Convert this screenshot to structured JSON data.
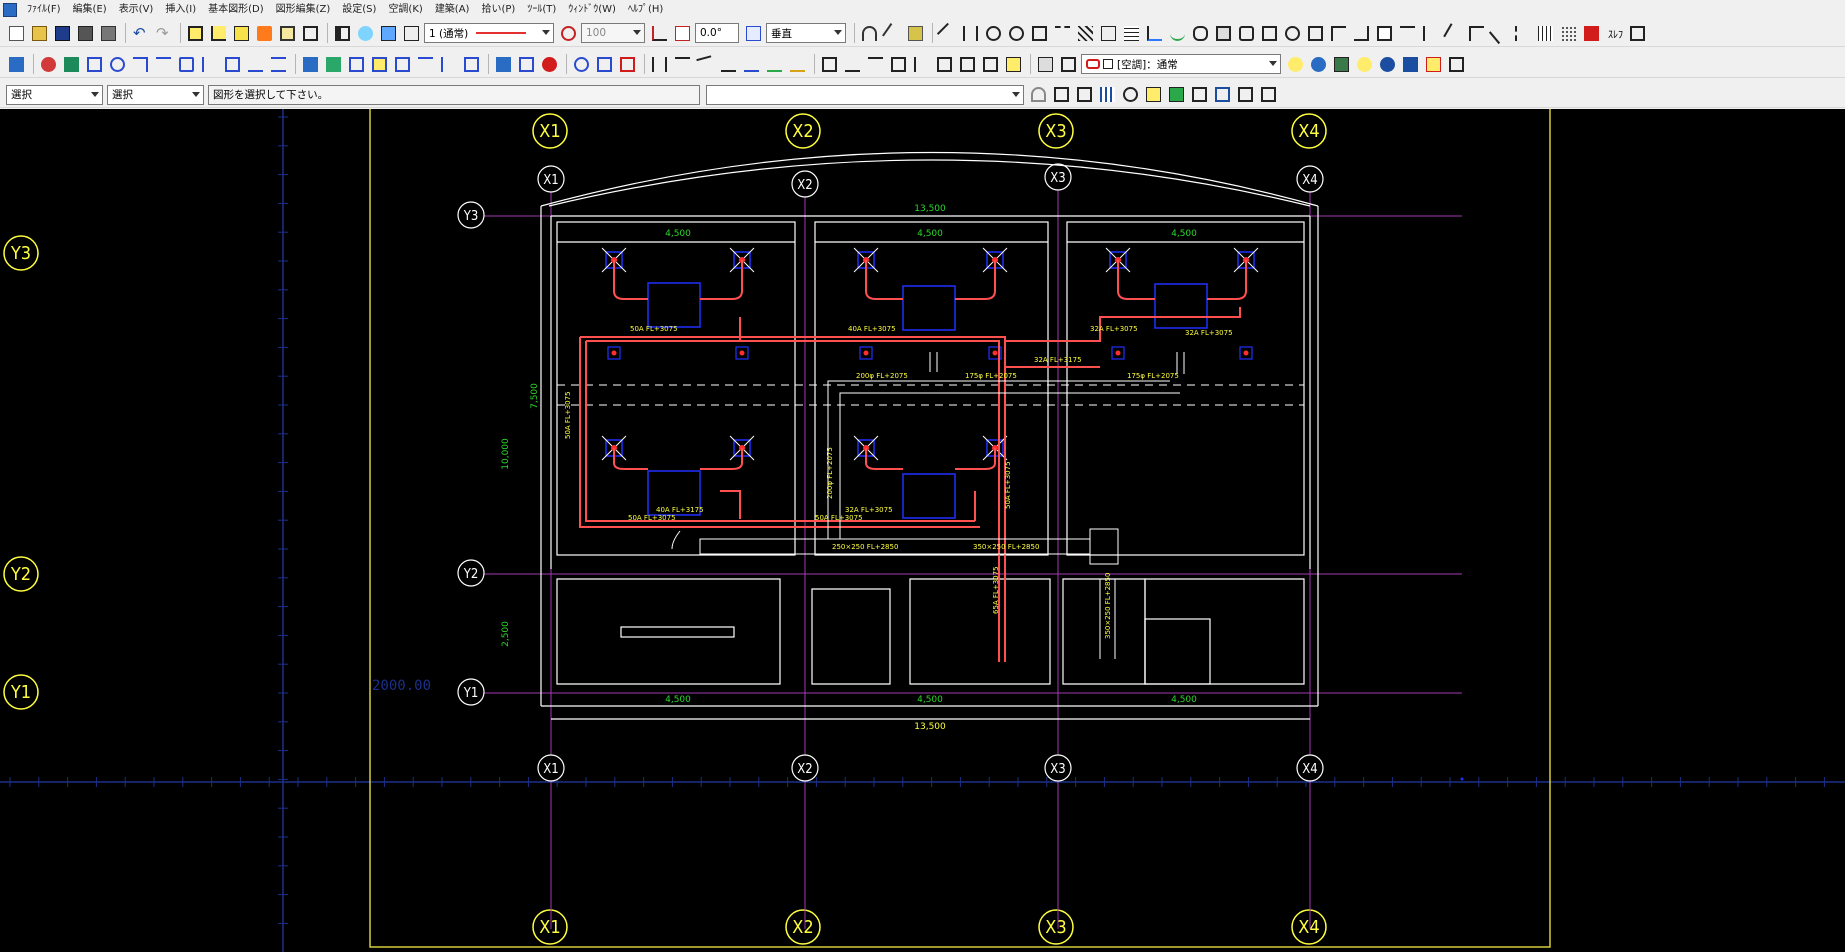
{
  "menu": [
    {
      "id": "file",
      "label": "ﾌｧｲﾙ(F)"
    },
    {
      "id": "edit",
      "label": "編集(E)"
    },
    {
      "id": "view",
      "label": "表示(V)"
    },
    {
      "id": "insert",
      "label": "挿入(I)"
    },
    {
      "id": "basic-shape",
      "label": "基本図形(D)"
    },
    {
      "id": "shape-edit",
      "label": "図形編集(Z)"
    },
    {
      "id": "settings",
      "label": "設定(S)"
    },
    {
      "id": "hvac",
      "label": "空調(K)"
    },
    {
      "id": "architecture",
      "label": "建築(A)"
    },
    {
      "id": "takeoff",
      "label": "拾い(P)"
    },
    {
      "id": "tools",
      "label": "ﾂｰﾙ(T)"
    },
    {
      "id": "window",
      "label": "ｳｨﾝﾄﾞｳ(W)"
    },
    {
      "id": "help",
      "label": "ﾍﾙﾌﾟ(H)"
    }
  ],
  "toolbar1": {
    "linetype_value": "1 (通常)",
    "scale_value": "100",
    "angle_value": "0.0°",
    "direction_value": "垂直",
    "extra_label": "ｽﾚﾌ"
  },
  "toolbar2": {
    "layer_value": "[空調]：通常"
  },
  "toolbar3": {
    "select_mode_1": "選択",
    "select_mode_2": "選択",
    "message": "図形を選択して下さい。",
    "command_value": ""
  },
  "drawing": {
    "outer_grid_labels": {
      "x": [
        "X1",
        "X2",
        "X3",
        "X4"
      ],
      "y": [
        "Y3",
        "Y2",
        "Y1"
      ]
    },
    "inner_grid_labels": {
      "x": [
        "X1",
        "X2",
        "X3",
        "X4"
      ],
      "y": [
        "Y3",
        "Y2",
        "Y1"
      ]
    },
    "coordinate_readout": "2000.00",
    "dimensions": {
      "top_total": "13,500",
      "top_spans": [
        "4,500",
        "4,500",
        "4,500"
      ],
      "bottom_spans": [
        "4,500",
        "4,500",
        "4,500"
      ],
      "bottom_total": "13,500",
      "left_upper": "7,500",
      "left_total": "10,000",
      "left_lower": "2,500"
    },
    "pipe_labels": [
      "50A FL+3075",
      "40A FL+3075",
      "32A FL+3075",
      "32A FL+3175",
      "50A FL+3075",
      "40A FL+3175",
      "50A FL+3075",
      "32A FL+3075",
      "50A FL+3075",
      "65A FL+3075",
      "50A FL+3075",
      "32A FL+3075"
    ],
    "duct_labels": [
      "200φ FL+2075",
      "175φ FL+2075",
      "175φ FL+2075",
      "200φ FL+2075",
      "250×250 FL+2850",
      "350×250 FL+2850",
      "350×250 FL+2850"
    ]
  },
  "colors": {
    "background": "#000000",
    "grid_line": "#a03ab0",
    "bubble": "#ffff40",
    "wall": "#ffffff",
    "pipe": "#ff5050",
    "unit": "#2030ff",
    "dimension": "#2bd62b",
    "paper_frame": "#d6cc3a",
    "axis": "#1c2f8a"
  }
}
